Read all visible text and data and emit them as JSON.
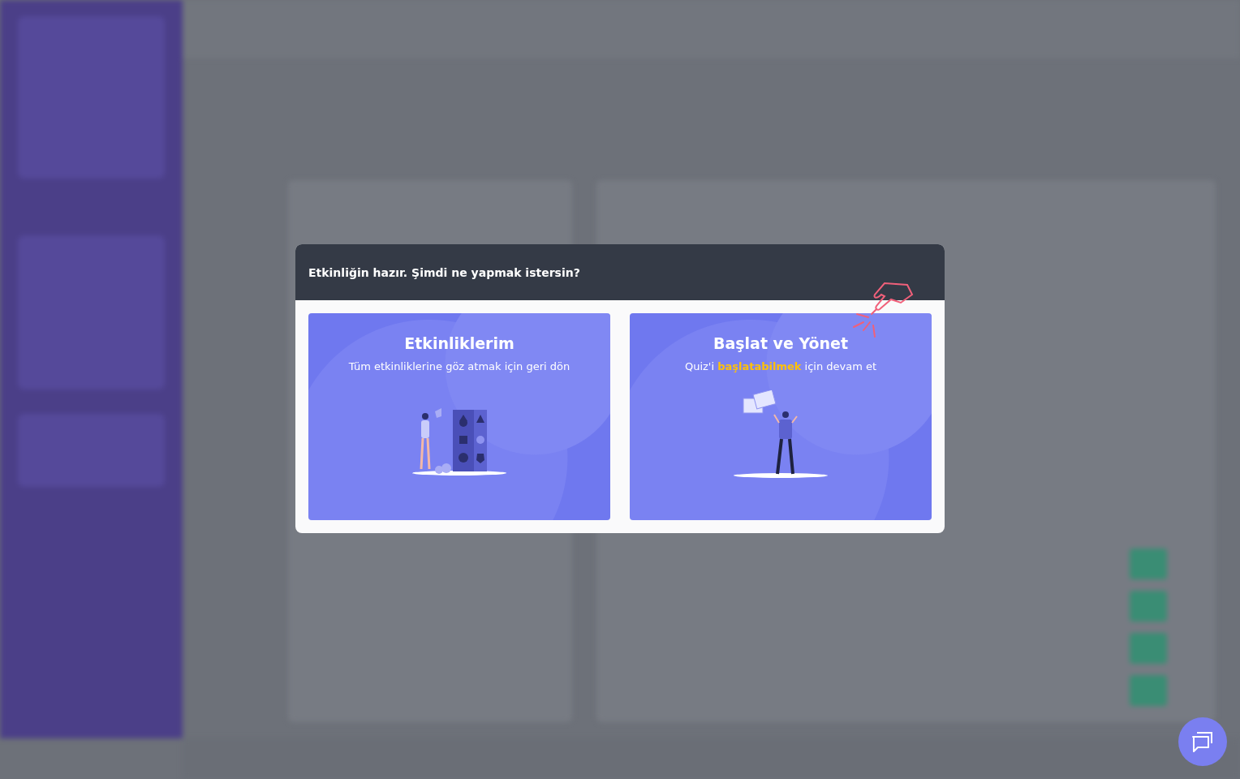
{
  "dialog": {
    "title": "Etkinliğin hazır. Şimdi ne yapmak istersin?",
    "cards": [
      {
        "kind": "activities",
        "title": "Etkinliklerim",
        "subtitle": "Tüm etkinliklerine göz atmak için geri dön"
      },
      {
        "kind": "start",
        "title": "Başlat ve Yönet",
        "subtitle": "Quiz'i **başlatabilmek** için devam et"
      }
    ]
  }
}
